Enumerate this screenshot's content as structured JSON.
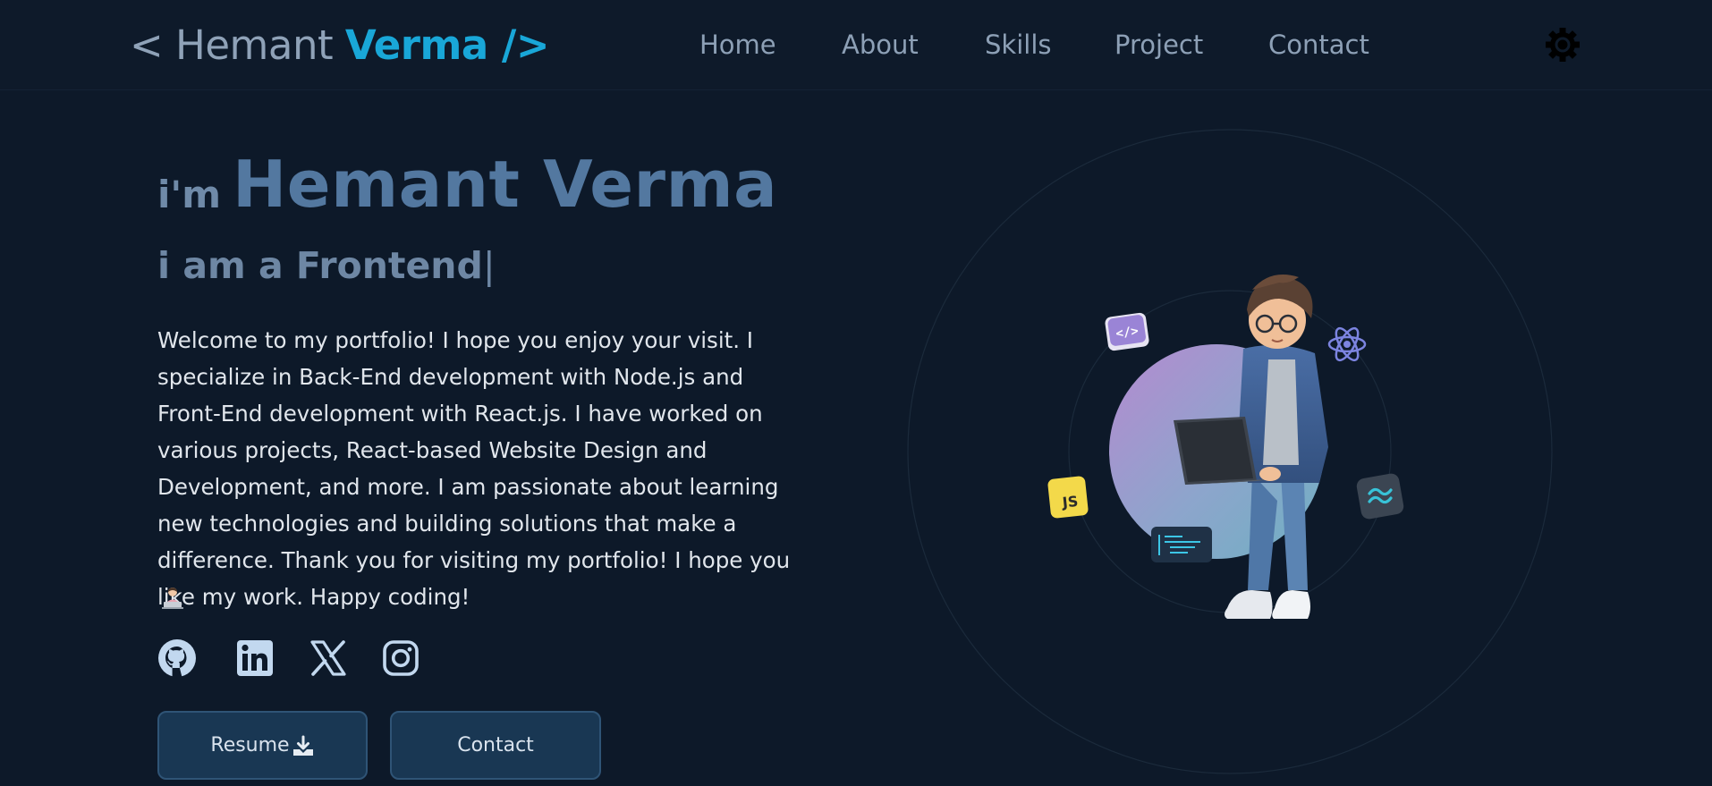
{
  "nav": {
    "logo_prefix": "< Hemant",
    "logo_suffix": "Verma />",
    "links": [
      "Home",
      "About",
      "Skills",
      "Project",
      "Contact"
    ]
  },
  "hero": {
    "im": "i'm",
    "name": "Hemant Verma",
    "role": "i am a Frontend",
    "cursor": "|",
    "intro": "Welcome to my portfolio! I hope you enjoy your visit. I specialize in Back-End development with Node.js and Front-End development with React.js. I have worked on various projects, React-based Website Design and Development, and more. I am passionate about learning new technologies and building solutions that make a difference. Thank you for visiting my portfolio! I hope you like my work. Happy coding!"
  },
  "socials": [
    "github-icon",
    "linkedin-icon",
    "x-icon",
    "instagram-icon"
  ],
  "buttons": {
    "resume": "Resume",
    "contact": "Contact"
  },
  "badges": {
    "js": "JS"
  },
  "colors": {
    "background": "#0d1929",
    "accent": "#19a7d8",
    "name": "#5378a0",
    "button_bg": "#193753"
  }
}
